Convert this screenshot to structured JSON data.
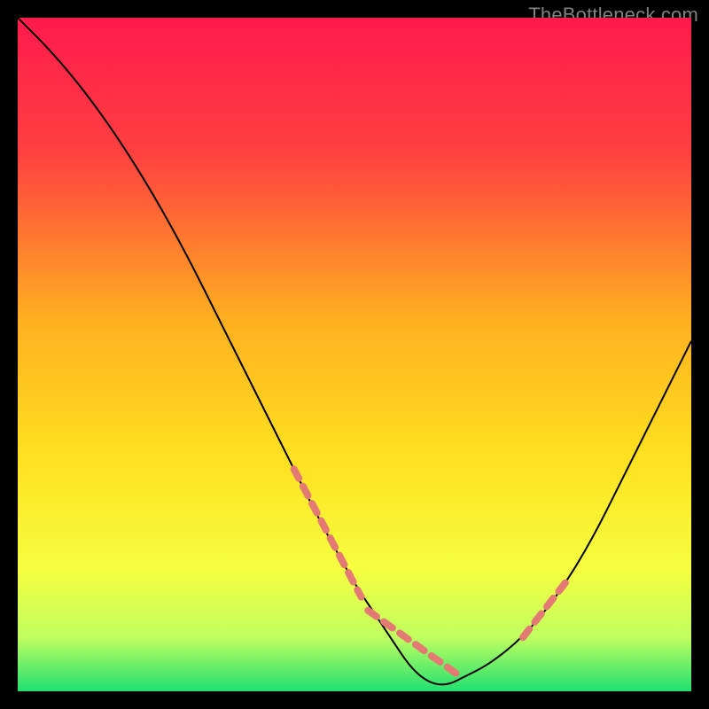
{
  "watermark": "TheBottleneck.com",
  "chart_data": {
    "type": "line",
    "title": "",
    "xlabel": "",
    "ylabel": "",
    "xlim": [
      0,
      100
    ],
    "ylim": [
      0,
      100
    ],
    "grid": false,
    "legend": false,
    "gradient_stops": [
      {
        "offset": 0,
        "color": "#ff1a4d"
      },
      {
        "offset": 20,
        "color": "#ff4040"
      },
      {
        "offset": 45,
        "color": "#ffb020"
      },
      {
        "offset": 65,
        "color": "#ffe020"
      },
      {
        "offset": 82,
        "color": "#f5ff40"
      },
      {
        "offset": 92,
        "color": "#c0ff60"
      },
      {
        "offset": 100,
        "color": "#20e070"
      }
    ],
    "series": [
      {
        "name": "bottleneck-curve",
        "x": [
          0,
          5,
          10,
          15,
          20,
          25,
          30,
          35,
          40,
          45,
          50,
          52,
          54,
          56,
          58,
          60,
          62,
          64,
          66,
          70,
          75,
          80,
          85,
          90,
          95,
          100
        ],
        "y": [
          100,
          95,
          89,
          82,
          74,
          65,
          55,
          45,
          35,
          25,
          16,
          13,
          10,
          7,
          4,
          2,
          1,
          1,
          2,
          4,
          8,
          14,
          22,
          32,
          42,
          52
        ]
      }
    ],
    "annotations": [
      {
        "name": "highlight-tick-left",
        "type": "dashed-segment",
        "x": [
          41,
          51
        ],
        "y": [
          33,
          14
        ],
        "color": "#e47a74"
      },
      {
        "name": "highlight-tick-bottom",
        "type": "dashed-segment",
        "x": [
          52,
          66
        ],
        "y": [
          12,
          2
        ],
        "color": "#e47a74"
      },
      {
        "name": "highlight-tick-right",
        "type": "dashed-segment",
        "x": [
          75,
          82
        ],
        "y": [
          8,
          17
        ],
        "color": "#e47a74"
      }
    ]
  }
}
